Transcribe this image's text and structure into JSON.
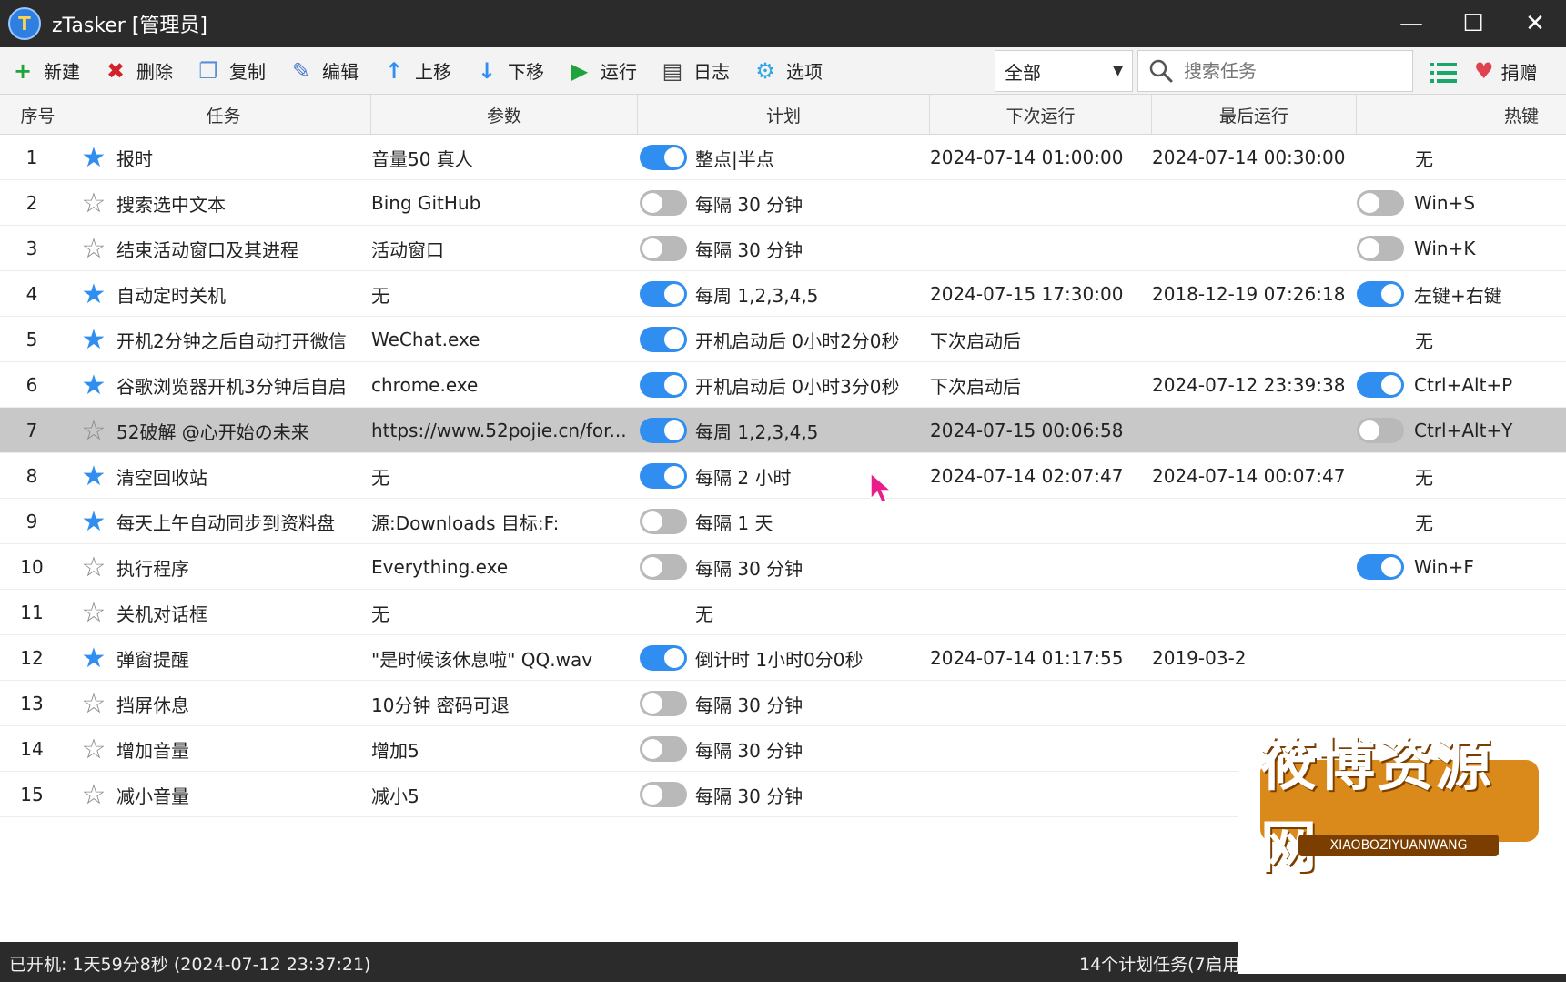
{
  "app": {
    "title": "zTasker [管理员]",
    "logo_letter": "T",
    "minimize_icon": "—",
    "maximize_icon": "☐",
    "close_icon": "✕"
  },
  "toolbar": {
    "buttons": [
      {
        "label": "新建",
        "icon": "plus-icon",
        "glyph": "+",
        "color": "#1fa33a"
      },
      {
        "label": "删除",
        "icon": "delete-icon",
        "glyph": "✖",
        "color": "#d2232a"
      },
      {
        "label": "复制",
        "icon": "copy-icon",
        "glyph": "❐",
        "color": "#5a8fd6"
      },
      {
        "label": "编辑",
        "icon": "edit-icon",
        "glyph": "✎",
        "color": "#4b7bc8"
      },
      {
        "label": "上移",
        "icon": "arrow-up-icon",
        "glyph": "↑",
        "color": "#2f8ef0"
      },
      {
        "label": "下移",
        "icon": "arrow-down-icon",
        "glyph": "↓",
        "color": "#2f8ef0"
      },
      {
        "label": "运行",
        "icon": "play-icon",
        "glyph": "▶",
        "color": "#1fa33a"
      },
      {
        "label": "日志",
        "icon": "log-icon",
        "glyph": "▤",
        "color": "#444"
      },
      {
        "label": "选项",
        "icon": "gear-icon",
        "glyph": "⚙",
        "color": "#2fa6e8"
      }
    ],
    "filter_value": "全部",
    "search_placeholder": "搜索任务",
    "donate_label": "捐赠"
  },
  "columns": {
    "num": "序号",
    "task": "任务",
    "param": "参数",
    "plan": "计划",
    "next": "下次运行",
    "last": "最后运行",
    "hotkey": "热键"
  },
  "rows": [
    {
      "num": "1",
      "star": true,
      "task": "报时",
      "param": "音量50 真人",
      "plan_toggle": "on",
      "plan": "整点|半点",
      "next": "2024-07-14 01:00:00",
      "last": "2024-07-14 00:30:00",
      "hot_toggle": "",
      "hotkey": "无"
    },
    {
      "num": "2",
      "star": false,
      "task": "搜索选中文本",
      "param": " Bing GitHub",
      "plan_toggle": "off",
      "plan": "每隔 30 分钟",
      "next": "",
      "last": "",
      "hot_toggle": "off",
      "hotkey": "Win+S"
    },
    {
      "num": "3",
      "star": false,
      "task": "结束活动窗口及其进程",
      "param": "活动窗口",
      "plan_toggle": "off",
      "plan": "每隔 30 分钟",
      "next": "",
      "last": "",
      "hot_toggle": "off",
      "hotkey": "Win+K"
    },
    {
      "num": "4",
      "star": true,
      "task": "自动定时关机",
      "param": "无",
      "plan_toggle": "on",
      "plan": "每周 1,2,3,4,5",
      "next": "2024-07-15 17:30:00",
      "last": "2018-12-19 07:26:18",
      "hot_toggle": "on",
      "hotkey": "左键+右键"
    },
    {
      "num": "5",
      "star": true,
      "task": "开机2分钟之后自动打开微信",
      "param": "WeChat.exe",
      "plan_toggle": "on",
      "plan": "开机启动后 0小时2分0秒",
      "next": "下次启动后",
      "last": "",
      "hot_toggle": "",
      "hotkey": "无"
    },
    {
      "num": "6",
      "star": true,
      "task": "谷歌浏览器开机3分钟后自启",
      "param": "chrome.exe",
      "plan_toggle": "on",
      "plan": "开机启动后 0小时3分0秒",
      "next": "下次启动后",
      "last": "2024-07-12 23:39:38",
      "hot_toggle": "on",
      "hotkey": "Ctrl+Alt+P"
    },
    {
      "num": "7",
      "star": false,
      "task": "52破解 @心开始の未来",
      "param": "https://www.52pojie.cn/for...",
      "plan_toggle": "on",
      "plan": "每周 1,2,3,4,5",
      "next": "2024-07-15 00:06:58",
      "last": "",
      "hot_toggle": "off",
      "hotkey": "Ctrl+Alt+Y",
      "selected": true
    },
    {
      "num": "8",
      "star": true,
      "task": "清空回收站",
      "param": "无",
      "plan_toggle": "on",
      "plan": "每隔 2 小时",
      "next": "2024-07-14 02:07:47",
      "last": "2024-07-14 00:07:47",
      "hot_toggle": "",
      "hotkey": "无"
    },
    {
      "num": "9",
      "star": true,
      "task": "每天上午自动同步到资料盘",
      "param": "源:Downloads 目标:F:",
      "plan_toggle": "off",
      "plan": "每隔 1 天",
      "next": "",
      "last": "",
      "hot_toggle": "",
      "hotkey": "无"
    },
    {
      "num": "10",
      "star": false,
      "task": "执行程序",
      "param": "Everything.exe",
      "plan_toggle": "off",
      "plan": "每隔 30 分钟",
      "next": "",
      "last": "",
      "hot_toggle": "on",
      "hotkey": "Win+F"
    },
    {
      "num": "11",
      "star": false,
      "task": "关机对话框",
      "param": "无",
      "plan_toggle": "",
      "plan": "无",
      "next": "",
      "last": "",
      "hot_toggle": "",
      "hotkey": ""
    },
    {
      "num": "12",
      "star": true,
      "task": "弹窗提醒",
      "param": "\"是时候该休息啦\" QQ.wav",
      "plan_toggle": "on",
      "plan": "倒计时 1小时0分0秒",
      "next": "2024-07-14 01:17:55",
      "last": "2019-03-2",
      "hot_toggle": "",
      "hotkey": ""
    },
    {
      "num": "13",
      "star": false,
      "task": "挡屏休息",
      "param": "10分钟 密码可退",
      "plan_toggle": "off",
      "plan": "每隔 30 分钟",
      "next": "",
      "last": "",
      "hot_toggle": "",
      "hotkey": ""
    },
    {
      "num": "14",
      "star": false,
      "task": "增加音量",
      "param": "增加5",
      "plan_toggle": "off",
      "plan": "每隔 30 分钟",
      "next": "",
      "last": "",
      "hot_toggle": "",
      "hotkey": ""
    },
    {
      "num": "15",
      "star": false,
      "task": "减小音量",
      "param": "减小5",
      "plan_toggle": "off",
      "plan": "每隔 30 分钟",
      "next": "",
      "last": "",
      "hot_toggle": "",
      "hotkey": ""
    }
  ],
  "status": {
    "left": "已开机: 1天59分8秒 (2024-07-12 23:37:21)",
    "right": "14个计划任务(7启用"
  },
  "watermark": {
    "title": "筱博资源网",
    "subtitle": "XIAOBOZIYUANWANG"
  },
  "colors": {
    "accent": "#2f8ef0",
    "selected_row": "#c8c8c8",
    "titlebar": "#2b2b2b"
  }
}
